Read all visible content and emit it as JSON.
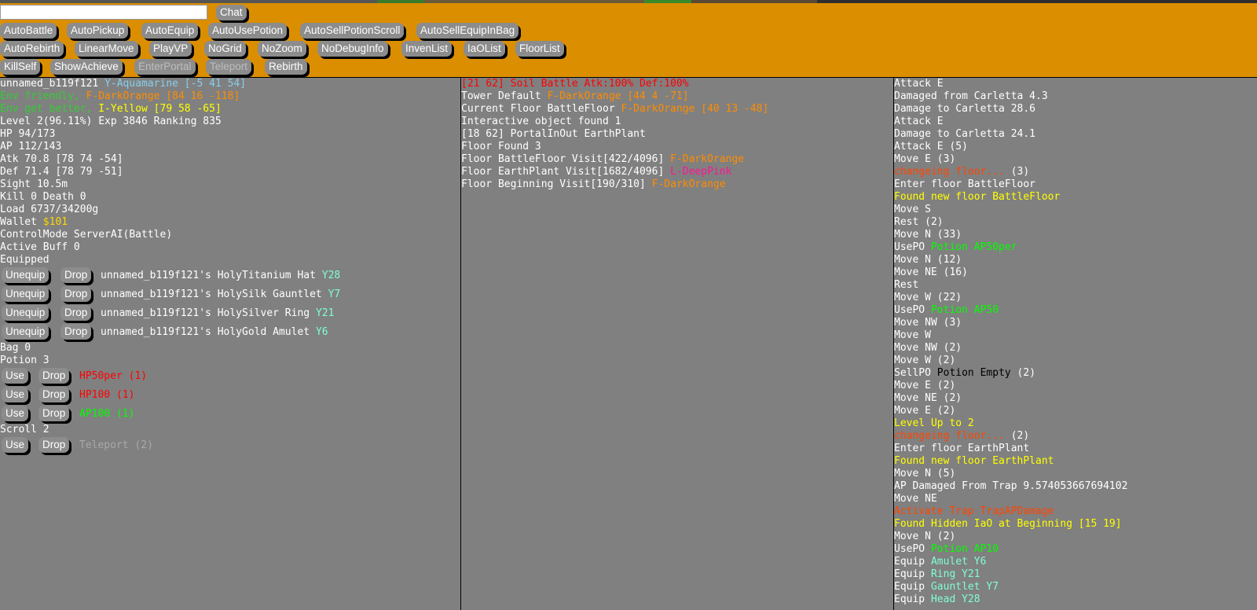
{
  "toolbar": {
    "chat_button": "Chat",
    "row1": [
      "AutoBattle",
      "AutoPickup",
      "AutoEquip",
      "AutoUsePotion",
      "AutoSellPotionScroll",
      "AutoSellEquipInBag"
    ],
    "row2": [
      "AutoRebirth",
      "LinearMove",
      "PlayVP",
      "NoGrid",
      "NoZoom",
      "NoDebugInfo",
      "InvenList",
      "IaOList",
      "FloorList"
    ],
    "row3": [
      "KillSelf",
      "ShowAchieve",
      "EnterPortal",
      "Teleport",
      "Rebirth"
    ]
  },
  "status": {
    "name": "unnamed_b119f121",
    "name_color": "Y-Aquamarine [-5 41 54]",
    "env_friendly_label": "Env friendly,",
    "env_friendly_value": "F-DarkOrange [84 16 -118]",
    "env_better_label": "Env get better,",
    "env_better_value": "I-Yellow [79 58 -65]",
    "level": "Level 2(96.11%) Exp 3846 Ranking 835",
    "hp": "HP 94/173",
    "ap": "AP 112/143",
    "atk": "Atk 70.8 [78 74 -54]",
    "def": "Def 71.4 [78 79 -51]",
    "sight": "Sight 10.5m",
    "kills": "Kill 0 Death 0",
    "load": "Load 6737/34200g",
    "wallet_label": "Wallet",
    "wallet_value": "$101",
    "control": "ControlMode ServerAI(Battle)",
    "buff": "Active Buff 0",
    "equipped_label": "Equipped",
    "unequip_label": "Unequip",
    "drop_label": "Drop",
    "use_label": "Use",
    "equipped": [
      {
        "name": "unnamed_b119f121's HolyTitanium Hat",
        "tag": "Y28"
      },
      {
        "name": "unnamed_b119f121's HolySilk Gauntlet",
        "tag": "Y7"
      },
      {
        "name": "unnamed_b119f121's HolySilver Ring",
        "tag": "Y21"
      },
      {
        "name": "unnamed_b119f121's HolyGold Amulet",
        "tag": "Y6"
      }
    ],
    "bag": "Bag 0",
    "potion_label": "Potion 3",
    "potions": [
      {
        "name": "HP50per (1)",
        "color": "#FF0000"
      },
      {
        "name": "HP100 (1)",
        "color": "#FF0000"
      },
      {
        "name": "AP100 (1)",
        "color": "#00FF00"
      }
    ],
    "scroll_label": "Scroll 2",
    "scrolls": [
      {
        "name": "Teleport (2)",
        "color": "#A9A9A9"
      }
    ]
  },
  "floor": {
    "header": "[21 62] Soil Battle Atk:100% Def:100%",
    "tower_label": "Tower Default",
    "tower_value": "F-DarkOrange [44 4 -71]",
    "current_label": "Current Floor BattleFloor",
    "current_value": "F-DarkOrange [40 13 -48]",
    "interactive": "Interactive object found 1",
    "portal": "[18 62] PortalInOut EarthPlant",
    "floor_found": "Floor Found 3",
    "floors": [
      {
        "label": "Floor BattleFloor Visit[422/4096]",
        "value": "F-DarkOrange",
        "color": "#FF8C00"
      },
      {
        "label": "Floor EarthPlant Visit[1682/4096]",
        "value": "L-DeepPink",
        "color": "#FF1493"
      },
      {
        "label": "Floor Beginning Visit[190/310]",
        "value": "F-DarkOrange",
        "color": "#FF8C00"
      }
    ]
  },
  "log": [
    {
      "a": "Attack E",
      "b": "",
      "c": "",
      "ca": "#ffffff",
      "cb": "#ffffff"
    },
    {
      "a": "Damaged from Carletta 4.3",
      "b": "",
      "c": "",
      "ca": "#ffffff",
      "cb": "#ffffff"
    },
    {
      "a": "Damage to Carletta 28.6",
      "b": "",
      "c": "",
      "ca": "#ffffff",
      "cb": "#ffffff"
    },
    {
      "a": "Attack E",
      "b": "",
      "c": "",
      "ca": "#ffffff",
      "cb": "#ffffff"
    },
    {
      "a": "Damage to Carletta 24.1",
      "b": "",
      "c": "",
      "ca": "#ffffff",
      "cb": "#ffffff"
    },
    {
      "a": "Attack E (5)",
      "b": "",
      "c": "",
      "ca": "#ffffff",
      "cb": "#ffffff"
    },
    {
      "a": "Move E (3)",
      "b": "",
      "c": "",
      "ca": "#ffffff",
      "cb": "#ffffff"
    },
    {
      "a": "changeing floor...",
      "b": " (3)",
      "c": "",
      "ca": "#FF4500",
      "cb": "#ffffff"
    },
    {
      "a": "Enter floor BattleFloor",
      "b": "",
      "c": "",
      "ca": "#ffffff",
      "cb": "#ffffff"
    },
    {
      "a": "Found new floor BattleFloor",
      "b": "",
      "c": "",
      "ca": "#FFFF00",
      "cb": "#ffffff"
    },
    {
      "a": "Move S",
      "b": "",
      "c": "",
      "ca": "#ffffff",
      "cb": "#ffffff"
    },
    {
      "a": "Rest (2)",
      "b": "",
      "c": "",
      "ca": "#ffffff",
      "cb": "#ffffff"
    },
    {
      "a": "Move N (33)",
      "b": "",
      "c": "",
      "ca": "#ffffff",
      "cb": "#ffffff"
    },
    {
      "a": "UsePO ",
      "b": "Potion AP50per",
      "c": "",
      "ca": "#ffffff",
      "cb": "#00FF00"
    },
    {
      "a": "Move N (12)",
      "b": "",
      "c": "",
      "ca": "#ffffff",
      "cb": "#ffffff"
    },
    {
      "a": "Move NE (16)",
      "b": "",
      "c": "",
      "ca": "#ffffff",
      "cb": "#ffffff"
    },
    {
      "a": "Rest",
      "b": "",
      "c": "",
      "ca": "#ffffff",
      "cb": "#ffffff"
    },
    {
      "a": "Move W (22)",
      "b": "",
      "c": "",
      "ca": "#ffffff",
      "cb": "#ffffff"
    },
    {
      "a": "UsePO ",
      "b": "Potion AP50",
      "c": "",
      "ca": "#ffffff",
      "cb": "#00FF00"
    },
    {
      "a": "Move NW (3)",
      "b": "",
      "c": "",
      "ca": "#ffffff",
      "cb": "#ffffff"
    },
    {
      "a": "Move W",
      "b": "",
      "c": "",
      "ca": "#ffffff",
      "cb": "#ffffff"
    },
    {
      "a": "Move NW (2)",
      "b": "",
      "c": "",
      "ca": "#ffffff",
      "cb": "#ffffff"
    },
    {
      "a": "Move W (2)",
      "b": "",
      "c": "",
      "ca": "#ffffff",
      "cb": "#ffffff"
    },
    {
      "a": "SellPO ",
      "b": "Potion Empty",
      "c": " (2)",
      "ca": "#ffffff",
      "cb": "#000000"
    },
    {
      "a": "Move E (2)",
      "b": "",
      "c": "",
      "ca": "#ffffff",
      "cb": "#ffffff"
    },
    {
      "a": "Move NE (2)",
      "b": "",
      "c": "",
      "ca": "#ffffff",
      "cb": "#ffffff"
    },
    {
      "a": "Move E (2)",
      "b": "",
      "c": "",
      "ca": "#ffffff",
      "cb": "#ffffff"
    },
    {
      "a": "Level Up to 2",
      "b": "",
      "c": "",
      "ca": "#FFFF00",
      "cb": "#ffffff"
    },
    {
      "a": "changeing floor...",
      "b": " (2)",
      "c": "",
      "ca": "#FF4500",
      "cb": "#ffffff"
    },
    {
      "a": "Enter floor EarthPlant",
      "b": "",
      "c": "",
      "ca": "#ffffff",
      "cb": "#ffffff"
    },
    {
      "a": "Found new floor EarthPlant",
      "b": "",
      "c": "",
      "ca": "#FFFF00",
      "cb": "#ffffff"
    },
    {
      "a": "Move N (5)",
      "b": "",
      "c": "",
      "ca": "#ffffff",
      "cb": "#ffffff"
    },
    {
      "a": "AP Damaged From Trap 9.574053667694102",
      "b": "",
      "c": "",
      "ca": "#ffffff",
      "cb": "#ffffff"
    },
    {
      "a": "Move NE",
      "b": "",
      "c": "",
      "ca": "#ffffff",
      "cb": "#ffffff"
    },
    {
      "a": "Activate Trap TrapAPDamage",
      "b": "",
      "c": "",
      "ca": "#FF4500",
      "cb": "#ffffff"
    },
    {
      "a": "Found Hidden IaO at Beginning [15 19]",
      "b": "",
      "c": "",
      "ca": "#FFFF00",
      "cb": "#ffffff"
    },
    {
      "a": "Move N (2)",
      "b": "",
      "c": "",
      "ca": "#ffffff",
      "cb": "#ffffff"
    },
    {
      "a": "UsePO ",
      "b": "Potion AP10",
      "c": "",
      "ca": "#ffffff",
      "cb": "#00FF00"
    },
    {
      "a": "Equip ",
      "b": "Amulet Y6",
      "c": "",
      "ca": "#ffffff",
      "cb": "#7FFFD4"
    },
    {
      "a": "Equip ",
      "b": "Ring Y21",
      "c": "",
      "ca": "#ffffff",
      "cb": "#7FFFD4"
    },
    {
      "a": "Equip ",
      "b": "Gauntlet Y7",
      "c": "",
      "ca": "#ffffff",
      "cb": "#7FFFD4"
    },
    {
      "a": "Equip ",
      "b": "Head Y28",
      "c": "",
      "ca": "#ffffff",
      "cb": "#7FFFD4"
    }
  ]
}
